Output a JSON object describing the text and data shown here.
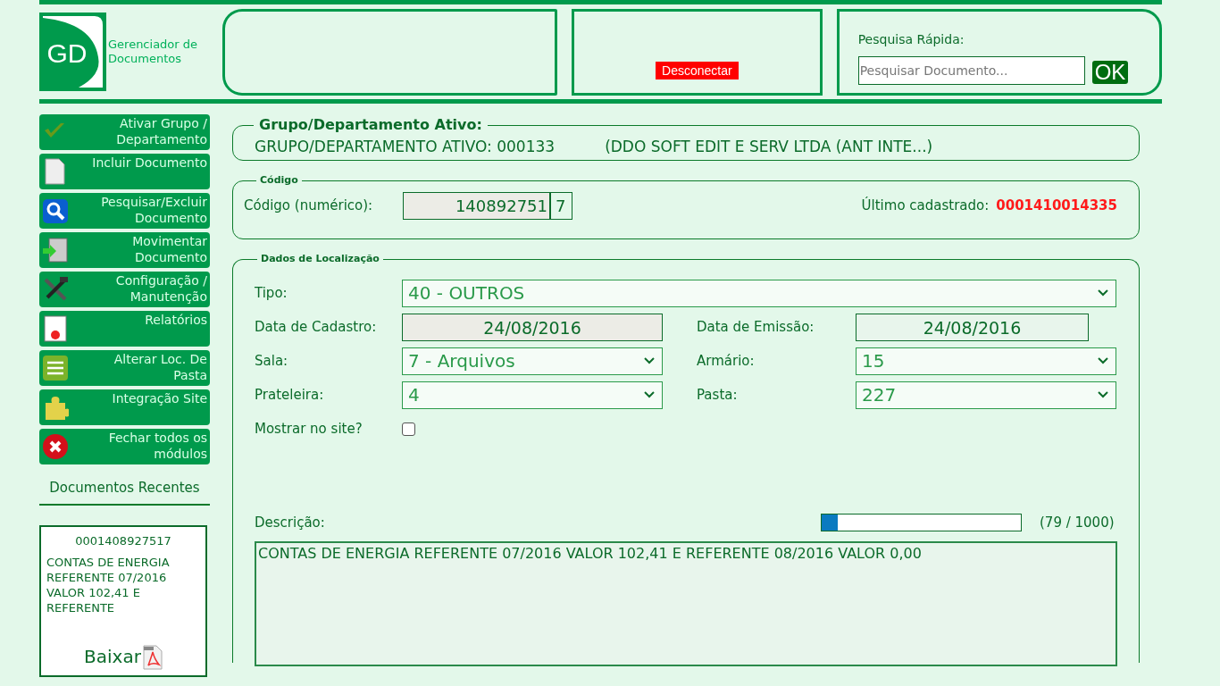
{
  "logo": {
    "mark": "GD",
    "title": "Gerenciador de Documentos"
  },
  "header": {
    "disconnect": "Desconectar",
    "search_label": "Pesquisa Rápida:",
    "search_placeholder": "Pesquisar Documento...",
    "search_button": "OK"
  },
  "menu": [
    {
      "label": "Ativar Grupo / Departamento"
    },
    {
      "label": "Incluir Documento"
    },
    {
      "label": "Pesquisar/Excluir Documento"
    },
    {
      "label": "Movimentar Documento"
    },
    {
      "label": "Configuração / Manutenção"
    },
    {
      "label": "Relatórios"
    },
    {
      "label": "Alterar Loc. De Pasta"
    },
    {
      "label": "Integração Site"
    },
    {
      "label": "Fechar todos os módulos"
    }
  ],
  "recent": {
    "title": "Documentos Recentes",
    "code": "0001408927517",
    "description": "CONTAS DE ENERGIA REFERENTE 07/2016 VALOR 102,41 E REFERENTE",
    "download": "Baixar"
  },
  "group": {
    "legend": "Grupo/Departamento Ativo:",
    "label": "GRUPO/DEPARTAMENTO ATIVO: 000133",
    "name": "(DDO SOFT EDIT E SERV LTDA (ANT INTE...)"
  },
  "code": {
    "legend": "Código",
    "label": "Código (numérico):",
    "value": "140892751",
    "check_digit": "7",
    "last_label": "Último cadastrado:",
    "last_value": "0001410014335"
  },
  "location": {
    "legend": "Dados de Localização",
    "tipo": {
      "label": "Tipo:",
      "value": "40 - OUTROS"
    },
    "data_cadastro": {
      "label": "Data de Cadastro:",
      "value": "24/08/2016"
    },
    "data_emissao": {
      "label": "Data de Emissão:",
      "value": "24/08/2016"
    },
    "sala": {
      "label": "Sala:",
      "value": "7 - Arquivos"
    },
    "armario": {
      "label": "Armário:",
      "value": "15"
    },
    "prateleira": {
      "label": "Prateleira:",
      "value": "4"
    },
    "pasta": {
      "label": "Pasta:",
      "value": "227"
    },
    "mostrar": {
      "label": "Mostrar no site?",
      "checked": false
    },
    "descricao": {
      "label": "Descrição:",
      "level": 0.079,
      "counter": "(79 / 1000)",
      "value": "CONTAS DE ENERGIA REFERENTE 07/2016 VALOR 102,41 E REFERENTE 08/2016 VALOR 0,00"
    }
  }
}
